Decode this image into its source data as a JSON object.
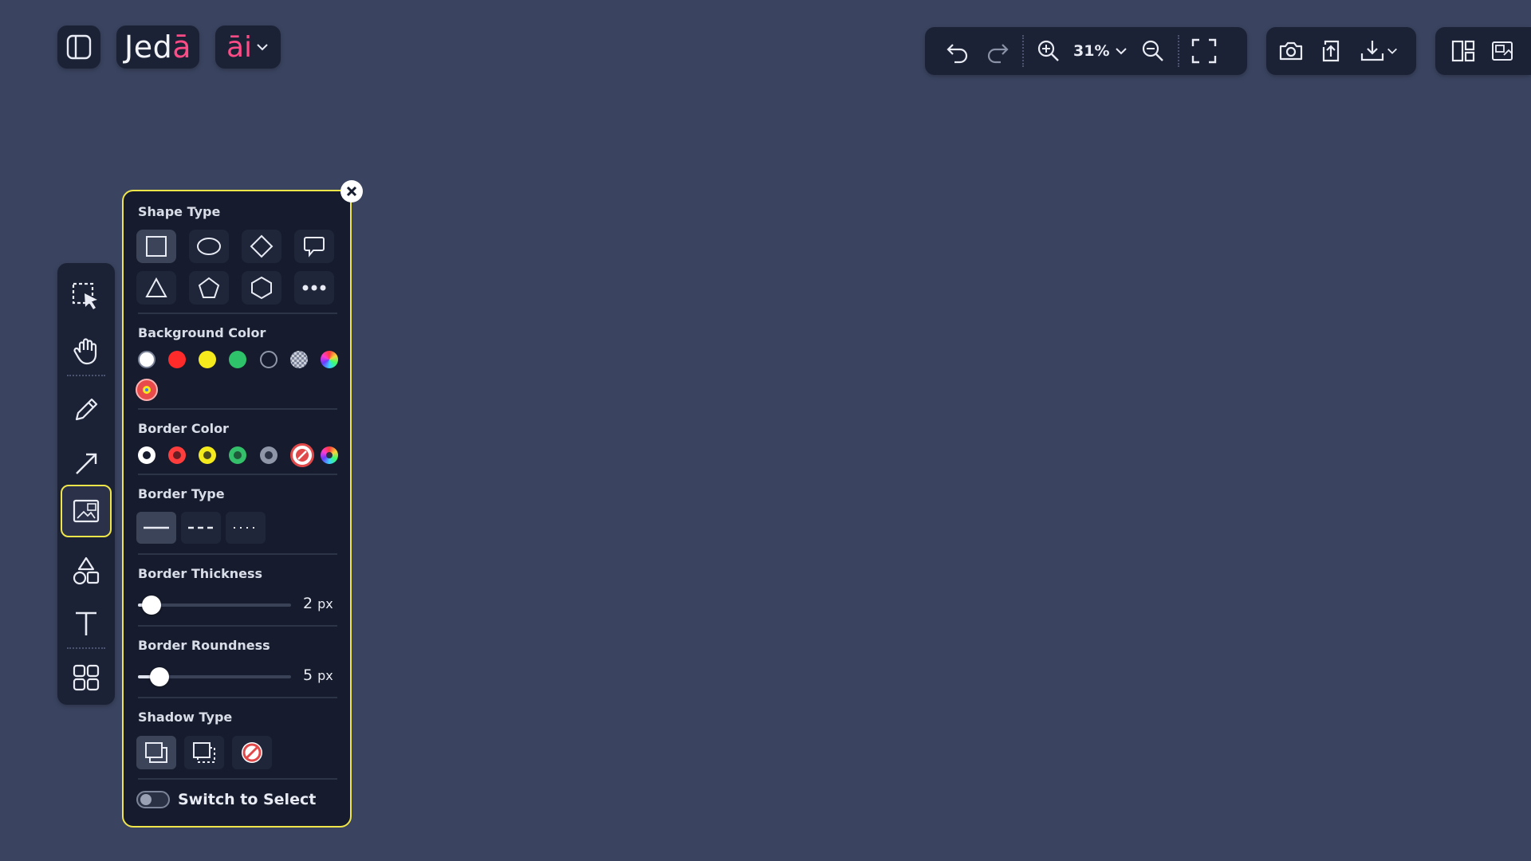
{
  "app": {
    "logo_prefix": "Jed",
    "logo_suffix": "ā",
    "ai_label": "āi"
  },
  "toolbar": {
    "zoom_value": "31%",
    "icons": [
      "undo-icon",
      "redo-icon",
      "zoom-in-icon",
      "zoom-out-icon",
      "fullscreen-icon",
      "camera-icon",
      "upload-icon",
      "download-icon",
      "layout-icon",
      "image-switch-icon"
    ]
  },
  "rail": {
    "tools": [
      "select",
      "pan",
      "pencil",
      "arrow",
      "frame",
      "shapes",
      "text",
      "grid"
    ],
    "active": "frame"
  },
  "panel": {
    "shape_type_title": "Shape Type",
    "shapes": [
      "rectangle",
      "ellipse",
      "diamond",
      "speech-bubble",
      "triangle",
      "pentagon",
      "hexagon",
      "more"
    ],
    "selected_shape": "rectangle",
    "background_color_title": "Background Color",
    "background_colors": [
      "#ffffff",
      "#ff2a2a",
      "#f5ea1c",
      "#2ec36a",
      "transparent",
      "checker",
      "rainbow",
      "custom"
    ],
    "border_color_title": "Border Color",
    "border_colors": [
      "#ffffff",
      "#ff3d3d",
      "#f5ea1c",
      "#34c06a",
      "#8f96a8",
      "none",
      "rainbow"
    ],
    "border_type_title": "Border Type",
    "border_types": [
      "solid",
      "dashed",
      "dotted"
    ],
    "selected_border_type": "solid",
    "border_thickness_title": "Border Thickness",
    "border_thickness_value": "2",
    "border_thickness_unit": "px",
    "border_thickness_fraction": 0.09,
    "border_roundness_title": "Border Roundness",
    "border_roundness_value": "5",
    "border_roundness_unit": "px",
    "border_roundness_fraction": 0.14,
    "shadow_type_title": "Shadow Type",
    "shadow_types": [
      "solid-shadow",
      "dashed-shadow",
      "no-shadow"
    ],
    "switch_label": "Switch to Select",
    "switch_on": false
  }
}
